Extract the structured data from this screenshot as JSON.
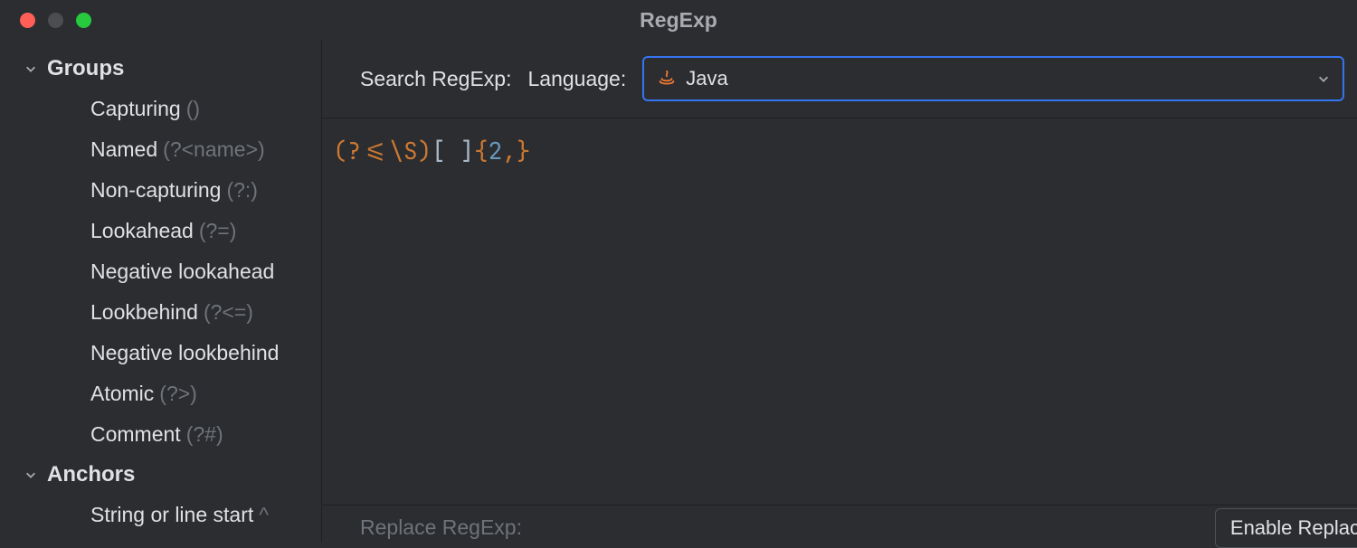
{
  "window": {
    "title": "RegExp"
  },
  "sidebar": {
    "sections": [
      {
        "label": "Groups",
        "expanded": true,
        "items": [
          {
            "label": "Capturing",
            "hint": "()"
          },
          {
            "label": "Named",
            "hint": "(?<name>)"
          },
          {
            "label": "Non-capturing",
            "hint": "(?:)"
          },
          {
            "label": "Lookahead",
            "hint": "(?=)"
          },
          {
            "label": "Negative lookahead",
            "hint": ""
          },
          {
            "label": "Lookbehind",
            "hint": "(?<=)"
          },
          {
            "label": "Negative lookbehind",
            "hint": ""
          },
          {
            "label": "Atomic",
            "hint": "(?>)"
          },
          {
            "label": "Comment",
            "hint": "(?#)"
          }
        ]
      },
      {
        "label": "Anchors",
        "expanded": true,
        "items": [
          {
            "label": "String or line start",
            "hint": "^"
          }
        ]
      }
    ]
  },
  "toolbar": {
    "search_label": "Search RegExp:",
    "language_label": "Language:",
    "language_value": "Java"
  },
  "editor": {
    "tokens": [
      {
        "t": "gold",
        "v": "(?<=\\S)"
      },
      {
        "t": "plain",
        "v": "[ ]"
      },
      {
        "t": "brace",
        "v": "{"
      },
      {
        "t": "num",
        "v": "2"
      },
      {
        "t": "brace",
        "v": ",}"
      }
    ]
  },
  "footer": {
    "replace_label": "Replace RegExp:",
    "enable_label": "Enable Replac"
  }
}
